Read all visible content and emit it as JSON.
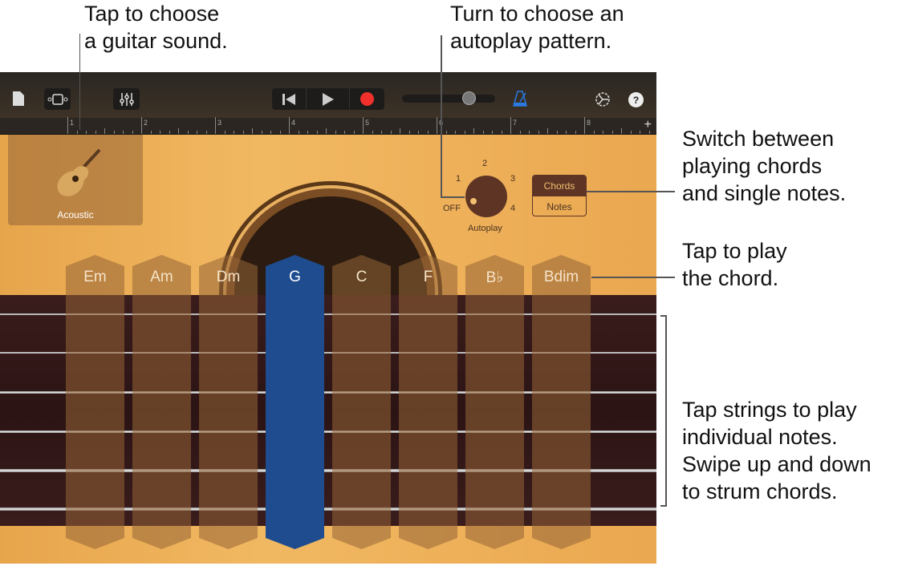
{
  "callouts": {
    "sound": [
      "Tap to choose",
      "a guitar sound."
    ],
    "autoplay": [
      "Turn to choose an",
      "autoplay pattern."
    ],
    "switch": [
      "Switch between",
      "playing chords",
      "and single notes."
    ],
    "play": [
      "Tap to play",
      "the chord."
    ],
    "strings": [
      "Tap strings to play",
      "individual notes.",
      "Swipe up and down",
      "to strum chords."
    ]
  },
  "toolbar": {
    "help": "?"
  },
  "ruler": [
    "1",
    "2",
    "3",
    "4",
    "5",
    "6",
    "7",
    "8"
  ],
  "instrument": {
    "name": "Acoustic"
  },
  "autoplay": {
    "label": "Autoplay",
    "positions": [
      "OFF",
      "1",
      "2",
      "3",
      "4"
    ],
    "value": "OFF"
  },
  "mode": {
    "chords": "Chords",
    "notes": "Notes",
    "selected": "Chords"
  },
  "chords": [
    "Em",
    "Am",
    "Dm",
    "G",
    "C",
    "F",
    "B♭",
    "Bdim"
  ],
  "selected_chord": "G",
  "colors": {
    "record": "#f2302b",
    "metronome": "#2a7ae2",
    "selected": "#1e4c8f"
  }
}
